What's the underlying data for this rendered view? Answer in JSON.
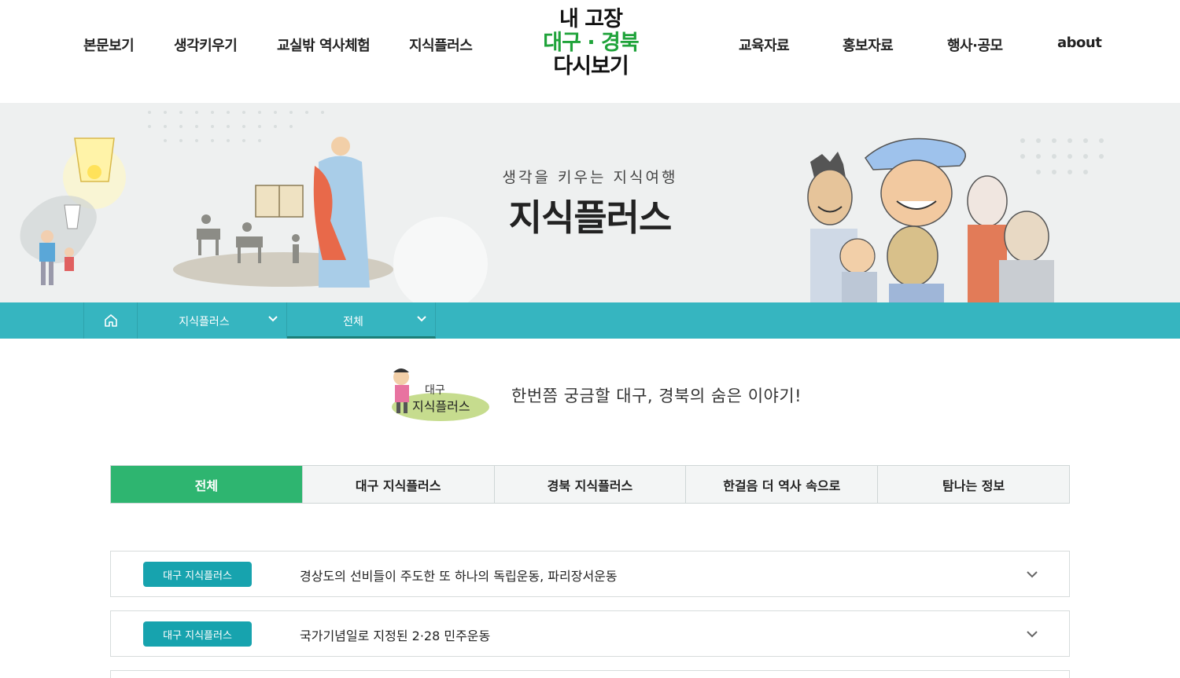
{
  "header": {
    "nav_left": [
      "본문보기",
      "생각키우기",
      "교실밖 역사체험",
      "지식플러스"
    ],
    "nav_right": [
      "교육자료",
      "홍보자료",
      "행사·공모",
      "about"
    ],
    "logo": {
      "line1": "내 고장",
      "line2": "대구 · 경북",
      "line3": "다시보기"
    }
  },
  "banner": {
    "subtitle": "생각을 키우는 지식여행",
    "title": "지식플러스"
  },
  "subnav": {
    "home_icon": "home-icon",
    "menu1": "지식플러스",
    "menu2": "전체"
  },
  "intro": {
    "badge_line1": "대구",
    "badge_line2": "지식플러스",
    "text": "한번쯤 궁금할 대구, 경북의 숨은 이야기!"
  },
  "tabs": [
    "전체",
    "대구 지식플러스",
    "경북 지식플러스",
    "한걸음 더 역사 속으로",
    "탐나는 정보"
  ],
  "list": [
    {
      "category": "대구 지식플러스",
      "title": "경상도의 선비들이 주도한 또 하나의 독립운동, 파리장서운동"
    },
    {
      "category": "대구 지식플러스",
      "title": "국가기념일로 지정된 2·28 민주운동"
    }
  ],
  "colors": {
    "brand_green": "#2eb570",
    "teal": "#36b5c0",
    "badge_teal": "#17a3ae",
    "logo_green": "#1fa33a"
  }
}
